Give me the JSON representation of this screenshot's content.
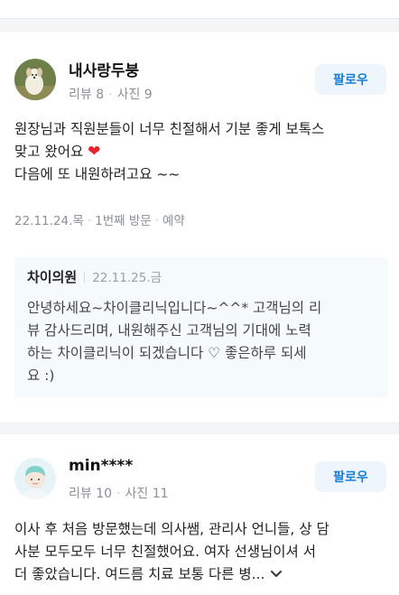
{
  "reviews": [
    {
      "username": "내사랑두붕",
      "review_count": "리뷰 8",
      "photo_count": "사진 9",
      "follow_label": "팔로우",
      "text_line1": "원장님과 직원분들이 너무 친절해서 기분 좋게 보톡스",
      "text_line2": "맞고 왔어요",
      "text_line3": "다음에 또 내원하려고요 ~~",
      "visit_date": "22.11.24.목",
      "visit_count": "1번째 방문",
      "visit_type": "예약",
      "reply": {
        "name": "차이의원",
        "date": "22.11.25.금",
        "line1": "안녕하세요~차이클리닉입니다~^^* 고객님의 리",
        "line2": "뷰 감사드리며, 내원해주신 고객님의 기대에 노력",
        "line3": "하는 차이클리닉이 되겠습니다 ♡ 좋은하루 되세",
        "line4": "요 :)"
      }
    },
    {
      "username": "min****",
      "review_count": "리뷰 10",
      "photo_count": "사진 11",
      "follow_label": "팔로우",
      "text_line1": "이사 후 처음 방문했는데 의사쌤, 관리사 언니들, 상 담",
      "text_line2": "사분 모두모두 너무 친절했어요. 여자 선생님이셔 서",
      "text_line3": "더 좋았습니다. 여드름 치료 보통 다른 병..."
    }
  ],
  "icons": {
    "heart": "heart-icon",
    "expand": "chevron-down-icon"
  },
  "colors": {
    "follow_text": "#1a7fd4",
    "follow_bg": "#eef6fb",
    "heart": "#e8232e"
  }
}
